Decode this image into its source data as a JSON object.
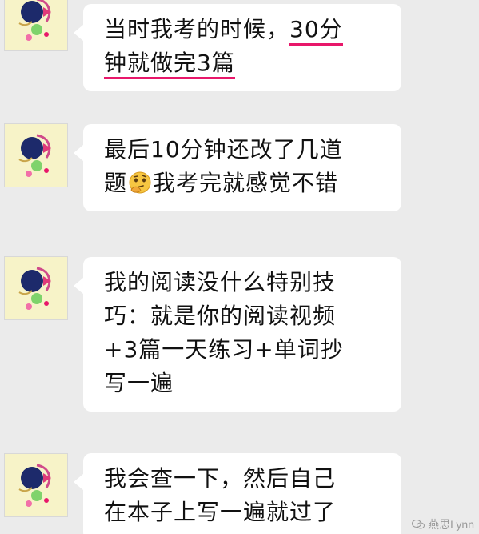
{
  "messages": [
    {
      "lines": [
        {
          "text": "当时我考的时候，",
          "highlight": "30分"
        },
        {
          "highlight": "钟就做完3篇",
          "text": ""
        }
      ]
    },
    {
      "lines": [
        {
          "text": "最后10分钟还改了几道"
        },
        {
          "before": "题",
          "emoji": "thinking-emoji",
          "after": "我考完就感觉不错"
        }
      ]
    },
    {
      "lines": [
        {
          "text": "我的阅读没什么特别技"
        },
        {
          "text": "巧：就是你的阅读视频"
        },
        {
          "text": "+3篇一天练习+单词抄"
        },
        {
          "text": "写一遍"
        }
      ]
    },
    {
      "lines": [
        {
          "text": "我会查一下，然后自己"
        },
        {
          "text": "在本子上写一遍就过了"
        }
      ]
    }
  ],
  "watermark": {
    "text": "燕思Lynn"
  },
  "colors": {
    "background": "#ebebeb",
    "bubble": "#ffffff",
    "underline": "#e8176a"
  }
}
